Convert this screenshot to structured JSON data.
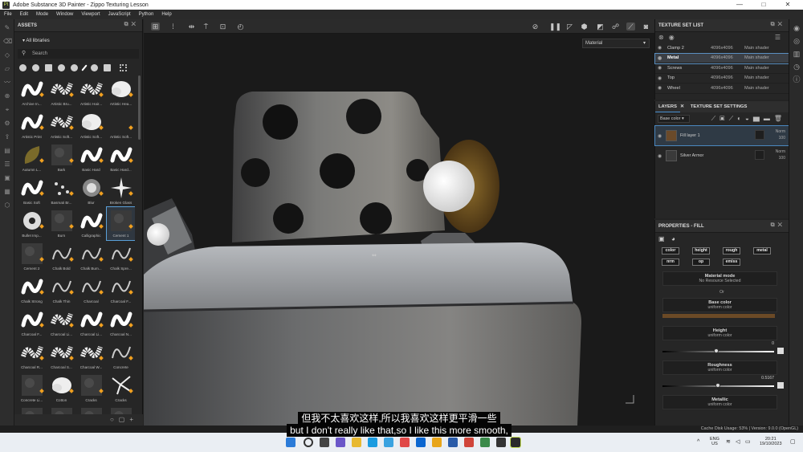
{
  "window": {
    "app_icon": "Pt",
    "title": "Adobe Substance 3D Painter - Zippo Texturing Lesson",
    "minimize": "—",
    "maximize": "□",
    "close": "✕"
  },
  "menu": [
    "File",
    "Edit",
    "Mode",
    "Window",
    "Viewport",
    "JavaScript",
    "Python",
    "Help"
  ],
  "assets": {
    "title": "ASSETS",
    "library": "All libraries",
    "search_placeholder": "Search",
    "items": [
      {
        "label": "Archive In...",
        "kind": "stroke"
      },
      {
        "label": "Artistic Bru...",
        "kind": "splat"
      },
      {
        "label": "Artistic Hair...",
        "kind": "splat"
      },
      {
        "label": "Artistic Hea...",
        "kind": "cloud"
      },
      {
        "label": "Artistic Print",
        "kind": "stroke"
      },
      {
        "label": "Artistic Soft...",
        "kind": "splat"
      },
      {
        "label": "Artistic Soft...",
        "kind": "cloud"
      },
      {
        "label": "Artistic Soft...",
        "kind": "empty"
      },
      {
        "label": "Autumn L...",
        "kind": "leaf"
      },
      {
        "label": "Bark",
        "kind": "dark"
      },
      {
        "label": "Basic Hard",
        "kind": "stroke"
      },
      {
        "label": "Basic Hard...",
        "kind": "stroke"
      },
      {
        "label": "Basic Soft",
        "kind": "stroke"
      },
      {
        "label": "Basmati Br...",
        "kind": "dots"
      },
      {
        "label": "Blur",
        "kind": "soft"
      },
      {
        "label": "Broken Glass",
        "kind": "burst"
      },
      {
        "label": "Bullet Imp...",
        "kind": "gear"
      },
      {
        "label": "Burn",
        "kind": "dark"
      },
      {
        "label": "Calligraphic",
        "kind": "stroke"
      },
      {
        "label": "Cement 1",
        "kind": "dark"
      },
      {
        "label": "Cement 2",
        "kind": "dark"
      },
      {
        "label": "Chalk Bold",
        "kind": "thin"
      },
      {
        "label": "Chalk Bum...",
        "kind": "thin"
      },
      {
        "label": "Chalk Spre...",
        "kind": "thin"
      },
      {
        "label": "Chalk Strong",
        "kind": "stroke"
      },
      {
        "label": "Chalk Thin",
        "kind": "thin"
      },
      {
        "label": "Charcoal",
        "kind": "thin"
      },
      {
        "label": "Charcoal F...",
        "kind": "thin"
      },
      {
        "label": "Charcoal F...",
        "kind": "stroke"
      },
      {
        "label": "Charcoal Li...",
        "kind": "splat"
      },
      {
        "label": "Charcoal Li...",
        "kind": "stroke"
      },
      {
        "label": "Charcoal N...",
        "kind": "stroke"
      },
      {
        "label": "Charcoal R...",
        "kind": "splat"
      },
      {
        "label": "Charcoal S...",
        "kind": "splat"
      },
      {
        "label": "Charcoal W...",
        "kind": "splat"
      },
      {
        "label": "Concrete",
        "kind": "thin"
      },
      {
        "label": "Concrete Li...",
        "kind": "dark"
      },
      {
        "label": "Cotton",
        "kind": "cloud"
      },
      {
        "label": "Cracks",
        "kind": "dark"
      },
      {
        "label": "Cracks",
        "kind": "crack"
      },
      {
        "label": "",
        "kind": "dark"
      },
      {
        "label": "",
        "kind": "dark"
      },
      {
        "label": "",
        "kind": "dark"
      },
      {
        "label": "",
        "kind": "dark"
      }
    ]
  },
  "viewport": {
    "material_mode": "Material",
    "subtitle_cn": "但我不太喜欢这样,所以我喜欢这样更平滑一些",
    "subtitle_en": "but I don't really like that,so I like this more smooth,"
  },
  "texture_sets": {
    "title": "TEXTURE SET LIST",
    "rows": [
      {
        "name": "Clamp 2",
        "res": "4096x4096",
        "shader": "Main shader",
        "selected": false
      },
      {
        "name": "Metal",
        "res": "4096x4096",
        "shader": "Main shader",
        "selected": true
      },
      {
        "name": "Screws",
        "res": "4096x4096",
        "shader": "Main shader",
        "selected": false
      },
      {
        "name": "Top",
        "res": "4096x4096",
        "shader": "Main shader",
        "selected": false
      },
      {
        "name": "Wheel",
        "res": "4096x4096",
        "shader": "Main shader",
        "selected": false
      }
    ]
  },
  "layers": {
    "tab_layers": "LAYERS",
    "tab_settings": "TEXTURE SET SETTINGS",
    "channel": "Base color",
    "rows": [
      {
        "name": "Fill layer 1",
        "blend": "Norm",
        "opacity": "100",
        "selected": true
      },
      {
        "name": "Silver Armor",
        "blend": "Norm",
        "opacity": "100",
        "selected": false
      }
    ]
  },
  "properties": {
    "title": "PROPERTIES - FILL",
    "channels": [
      "color",
      "height",
      "rough",
      "metal",
      "nrm",
      "op",
      "emiss"
    ],
    "material_mode_label": "Material mode",
    "material_mode_value": "No Resource Selected",
    "or_label": "Or",
    "base_color_label": "Base color",
    "base_color_value": "uniform color",
    "base_color_hex": "#6b4a26",
    "height_label": "Height",
    "height_sub": "uniform color",
    "height_value": "0",
    "height_fraction": 0.5,
    "roughness_label": "Roughness",
    "roughness_sub": "uniform color",
    "roughness_value": "0.5167",
    "roughness_fraction": 0.5167,
    "metallic_label": "Metallic",
    "metallic_sub": "uniform color"
  },
  "status": {
    "text": "Cache Disk Usage:  53% | Version: 9.0.0 (OpenGL)"
  },
  "taskbar": {
    "lang1": "ENG",
    "lang2": "US",
    "time": "20:21",
    "date": "19/10/2023"
  }
}
